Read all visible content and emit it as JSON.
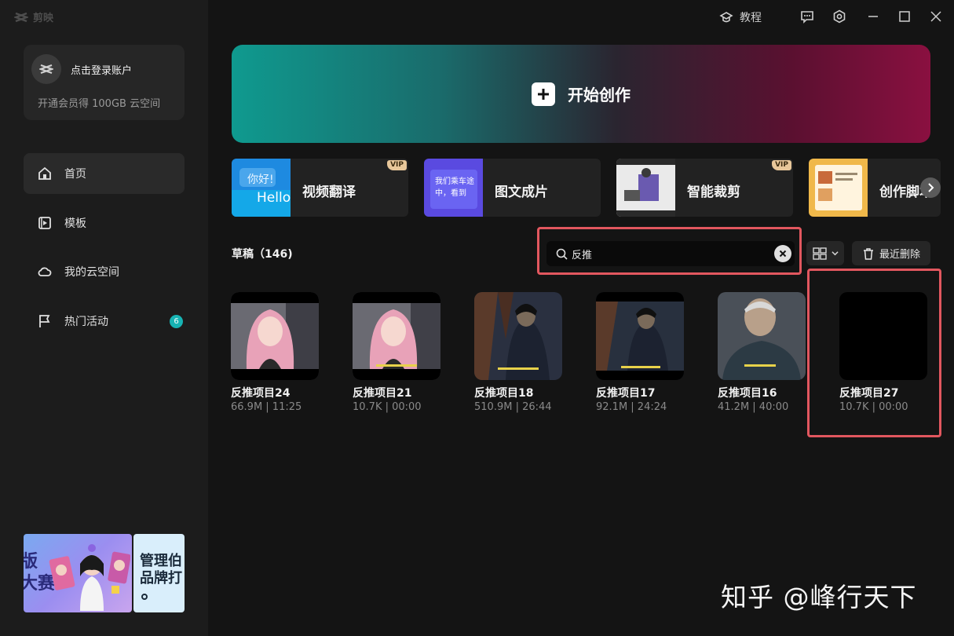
{
  "app": {
    "name": "剪映"
  },
  "titlebar": {
    "tutorial_label": "教程"
  },
  "account": {
    "login_label": "点击登录账户",
    "promo": "开通会员得 100GB 云空间"
  },
  "sidebar": {
    "items": [
      {
        "label": "首页",
        "icon": "home-icon",
        "active": true
      },
      {
        "label": "模板",
        "icon": "template-icon"
      },
      {
        "label": "我的云空间",
        "icon": "cloud-icon"
      },
      {
        "label": "热门活动",
        "icon": "flag-icon",
        "badge": "6"
      }
    ]
  },
  "banners": [
    {
      "text": "版\n大赛"
    },
    {
      "text": "管理伯\n品牌打"
    }
  ],
  "hero": {
    "label": "开始创作"
  },
  "tools": [
    {
      "label": "视频翻译",
      "vip": "VIP",
      "thumb_text_1": "你好!",
      "thumb_text_2": "Hello"
    },
    {
      "label": "图文成片",
      "thumb_text_1": "我们乘车途",
      "thumb_text_2": "中，看到"
    },
    {
      "label": "智能裁剪",
      "vip": "VIP"
    },
    {
      "label": "创作脚本"
    }
  ],
  "drafts": {
    "title": "草稿（146)"
  },
  "search": {
    "value": "反推",
    "placeholder": ""
  },
  "actions": {
    "recent_delete": "最近删除"
  },
  "projects": [
    {
      "name": "反推项目24",
      "meta": "66.9M | 11:25",
      "thumb": "pink-hair-girl"
    },
    {
      "name": "反推项目21",
      "meta": "10.7K | 00:00",
      "thumb": "pink-hair-girl"
    },
    {
      "name": "反推项目18",
      "meta": "510.9M | 26:44",
      "thumb": "man-tree-night"
    },
    {
      "name": "反推项目17",
      "meta": "92.1M | 24:24",
      "thumb": "man-tree-night"
    },
    {
      "name": "反推项目16",
      "meta": "41.2M | 40:00",
      "thumb": "old-man"
    },
    {
      "name": "反推项目27",
      "meta": "10.7K | 00:00",
      "thumb": "black"
    }
  ],
  "watermark": "知乎 @峰行天下",
  "colors": {
    "accent": "#17b3b3",
    "highlight": "#e2575f",
    "vip": "#e8c79a"
  }
}
